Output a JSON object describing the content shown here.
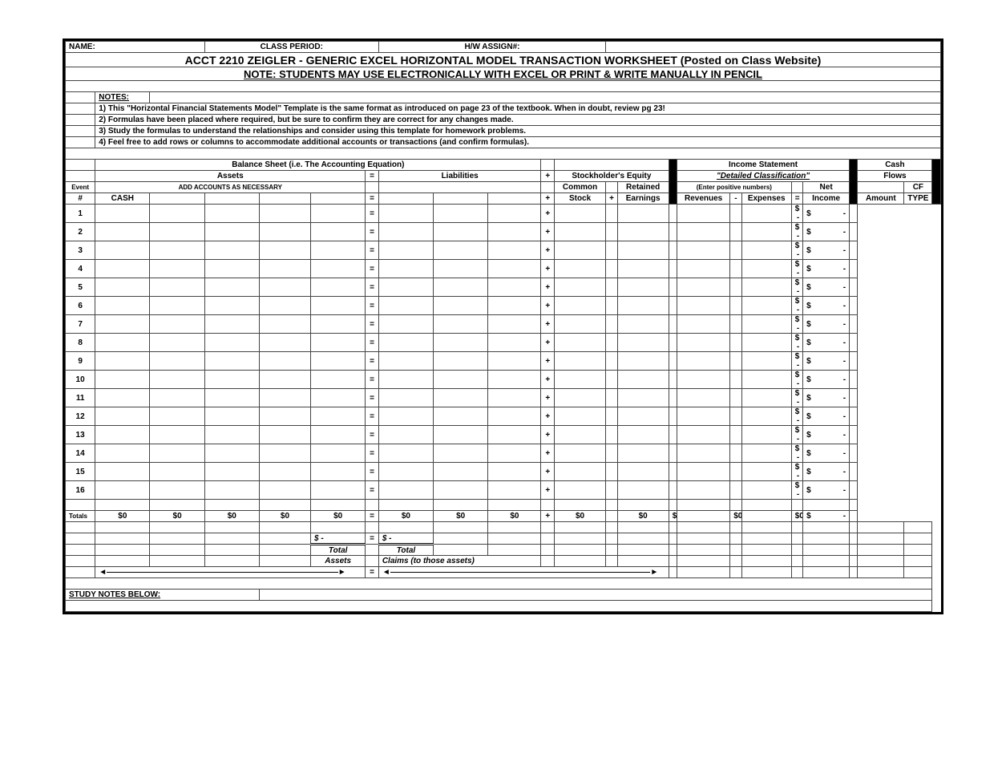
{
  "header": {
    "name_label": "NAME:",
    "class_period_label": "CLASS PERIOD:",
    "hw_assign_label": "H/W ASSIGN#:",
    "title": "ACCT 2210 ZEIGLER - GENERIC EXCEL HORIZONTAL MODEL TRANSACTION WORKSHEET (Posted on Class Website)",
    "subtitle": "NOTE: STUDENTS MAY USE ELECTRONICALLY WITH EXCEL OR PRINT & WRITE MANUALLY IN PENCIL"
  },
  "notes": {
    "heading": "NOTES:",
    "n1": "1) This \"Horizontal Financial Statements Model\" Template is the same format as introduced on page 23 of the textbook. When in doubt, review pg 23!",
    "n2": "2) Formulas have been placed where required, but be sure to confirm they are correct for any changes made.",
    "n3": "3) Study the formulas to understand the relationships and consider using this template for homework problems.",
    "n4": "4) Feel free to add rows or columns to accommodate additional accounts or transactions (and confirm formulas)."
  },
  "sections": {
    "balance_sheet": "Balance Sheet (i.e. The Accounting Equation)",
    "income_statement": "Income Statement",
    "cash": "Cash",
    "assets": "Assets",
    "liabilities": "Liabilities",
    "equity": "Stockholder's Equity",
    "detailed": "\"Detailed Classification\"",
    "flows": "Flows",
    "eq": "=",
    "plus": "+",
    "minus": "-"
  },
  "cols": {
    "event": "Event",
    "add_accounts": "ADD ACCOUNTS AS NECESSARY",
    "common": "Common",
    "retained": "Retained",
    "enter_pos": "(Enter positive numbers)",
    "net": "Net",
    "num": "#",
    "cash": "CASH",
    "stock": "Stock",
    "earnings": "Earnings",
    "revenues": "Revenues",
    "expenses": "Expenses",
    "income": "Income",
    "amount": "Amount",
    "type": "TYPE",
    "cf": "CF"
  },
  "rows": {
    "labels": [
      "1",
      "2",
      "3",
      "4",
      "5",
      "6",
      "7",
      "8",
      "9",
      "10",
      "11",
      "12",
      "13",
      "14",
      "15",
      "16"
    ],
    "dollar": "$",
    "dash": "-",
    "totals": "Totals",
    "zero": "$0"
  },
  "footer": {
    "dollar_dash": "$        -",
    "total": "Total",
    "assets": "Assets",
    "claims": "Claims (to those assets)",
    "study": "STUDY NOTES BELOW:"
  }
}
